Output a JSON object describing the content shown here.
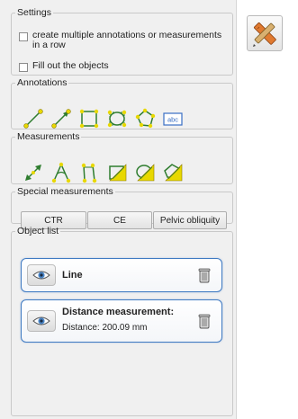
{
  "settings": {
    "legend": "Settings",
    "multi_label": "create multiple annotations or measurements in a row",
    "fill_label": "Fill out the objects"
  },
  "annotations": {
    "legend": "Annotations",
    "tools": [
      "line-tool-icon",
      "arrow-tool-icon",
      "rectangle-tool-icon",
      "ellipse-tool-icon",
      "polygon-tool-icon",
      "text-tool-icon"
    ],
    "text_tool_label": "abc"
  },
  "measurements": {
    "legend": "Measurements",
    "tools": [
      "distance-tool-icon",
      "angle-tool-icon",
      "parallel-tool-icon",
      "area-rect-tool-icon",
      "area-ellipse-tool-icon",
      "area-polygon-tool-icon"
    ]
  },
  "special": {
    "legend": "Special measurements",
    "buttons": [
      "CTR",
      "CE",
      "Pelvic obliquity"
    ]
  },
  "objects": {
    "legend": "Object list",
    "items": [
      {
        "title": "Line",
        "subtitle": ""
      },
      {
        "title": "Distance measurement:",
        "subtitle": "Distance: 200.09 mm"
      }
    ]
  },
  "colors": {
    "accent": "#3f7ac2",
    "tool_fill": "#e8d800",
    "tool_stroke": "#2f7d2f"
  }
}
